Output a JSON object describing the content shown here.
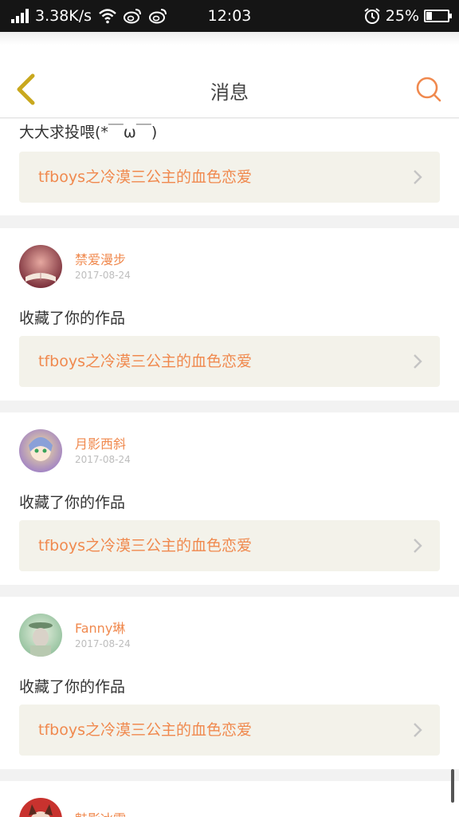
{
  "status_bar": {
    "speed": "3.38K/s",
    "time": "12:03",
    "battery_percent": "25%",
    "battery_level": 0.25,
    "icons": [
      "signal-icon",
      "wifi-icon",
      "weibo-icon",
      "weibo-icon",
      "alarm-icon",
      "battery-icon"
    ]
  },
  "header": {
    "title": "消息",
    "back_icon": "chevron-left-icon",
    "search_icon": "search-icon"
  },
  "colors": {
    "accent": "#f0894e",
    "back_icon": "#c9a81e",
    "card_link_bg": "#f3f2ea",
    "feed_bg": "#f2f2f2"
  },
  "messages": [
    {
      "text": "大大求投喂(*￣ω￣)",
      "work_title": "tfboys之冷漠三公主的血色恋爱"
    },
    {
      "user": "禁爱漫步",
      "date": "2017-08-24",
      "text": "收藏了你的作品",
      "work_title": "tfboys之冷漠三公主的血色恋爱"
    },
    {
      "user": "月影西斜",
      "date": "2017-08-24",
      "text": "收藏了你的作品",
      "work_title": "tfboys之冷漠三公主的血色恋爱"
    },
    {
      "user": "Fanny琳",
      "date": "2017-08-24",
      "text": "收藏了你的作品",
      "work_title": "tfboys之冷漠三公主的血色恋爱"
    },
    {
      "user": "魅影冰霜"
    }
  ]
}
